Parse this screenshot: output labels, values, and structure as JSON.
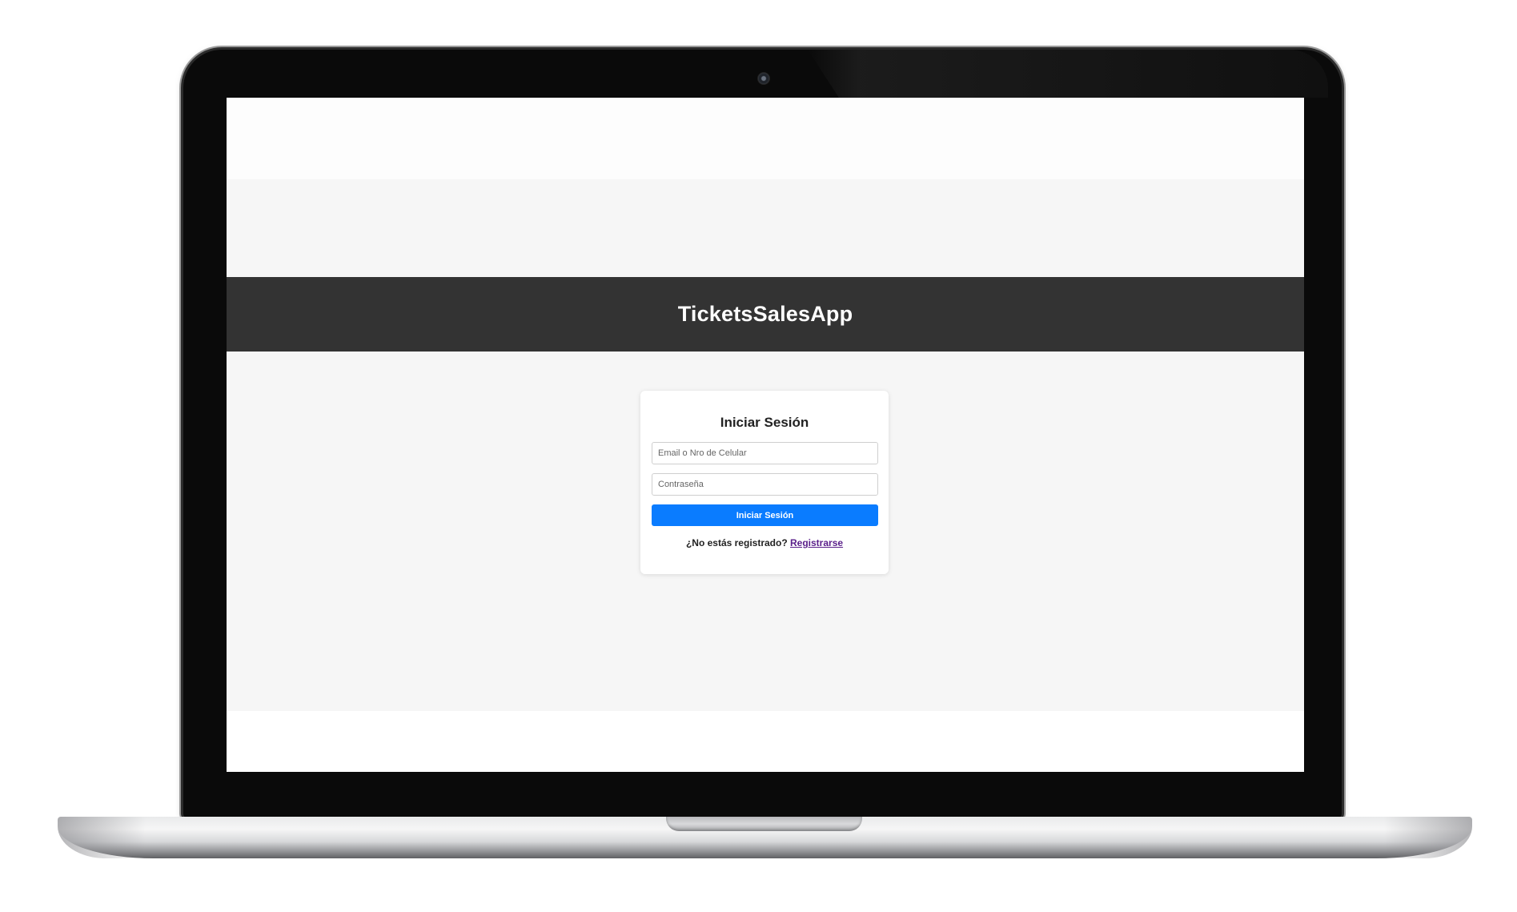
{
  "app": {
    "title": "TicketsSalesApp"
  },
  "login": {
    "heading": "Iniciar Sesión",
    "email_placeholder": "Email o Nro de Celular",
    "email_value": "",
    "password_placeholder": "Contraseña",
    "password_value": "",
    "submit_label": "Iniciar Sesión",
    "register_prompt": "¿No estás registrado?",
    "register_link": "Registrarse"
  },
  "colors": {
    "header_bg": "#333333",
    "primary_button": "#0a7cff",
    "link": "#5a1f8a",
    "page_bg": "#f6f6f6"
  }
}
